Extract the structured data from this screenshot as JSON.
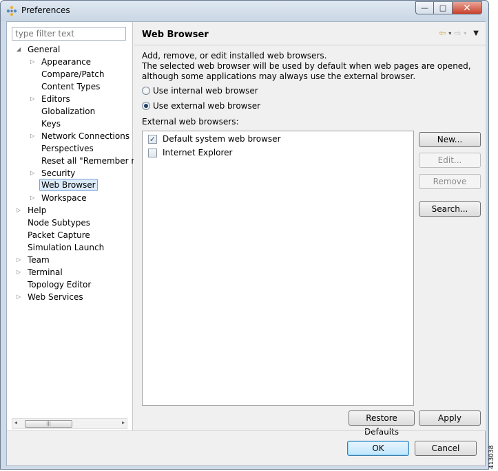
{
  "window": {
    "title": "Preferences",
    "minimize": "—",
    "maximize": "□",
    "close": "✕"
  },
  "filter": {
    "placeholder": "type filter text"
  },
  "tree": {
    "items": [
      {
        "label": "General",
        "arrow": "◢"
      },
      {
        "label": "Appearance",
        "arrow": "▷"
      },
      {
        "label": "Compare/Patch"
      },
      {
        "label": "Content Types"
      },
      {
        "label": "Editors",
        "arrow": "▷"
      },
      {
        "label": "Globalization"
      },
      {
        "label": "Keys"
      },
      {
        "label": "Network Connections",
        "arrow": "▷"
      },
      {
        "label": "Perspectives"
      },
      {
        "label": "Reset all \"Remember m"
      },
      {
        "label": "Security",
        "arrow": "▷"
      },
      {
        "label": "Web Browser"
      },
      {
        "label": "Workspace",
        "arrow": "▷"
      },
      {
        "label": "Help",
        "arrow": "▷"
      },
      {
        "label": "Node Subtypes"
      },
      {
        "label": "Packet Capture"
      },
      {
        "label": "Simulation Launch"
      },
      {
        "label": "Team",
        "arrow": "▷"
      },
      {
        "label": "Terminal",
        "arrow": "▷"
      },
      {
        "label": "Topology Editor"
      },
      {
        "label": "Web Services",
        "arrow": "▷"
      }
    ],
    "scroll": {
      "left": "◂",
      "right": "▸",
      "grip": "|||"
    }
  },
  "page": {
    "title": "Web Browser",
    "nav": {
      "back": "⇦",
      "dropdown": "▾",
      "forward": "⇨",
      "menu": "▼"
    },
    "desc_line1": "Add, remove, or edit installed web browsers.",
    "desc_line2": "The selected web browser will be used by default when web pages are opened, although some applications may always use the external browser.",
    "radio_internal": "Use internal web browser",
    "radio_external": "Use external web browser",
    "selected_radio": "external",
    "list_label": "External web browsers:",
    "browsers": [
      {
        "name": "Default system web browser",
        "checked": true,
        "mark": "✓"
      },
      {
        "name": "Internet Explorer",
        "checked": false,
        "mark": ""
      }
    ],
    "buttons": {
      "new": "New...",
      "edit": "Edit...",
      "remove": "Remove",
      "search": "Search...",
      "restore": "Restore Defaults",
      "apply": "Apply"
    }
  },
  "footer": {
    "ok": "OK",
    "cancel": "Cancel"
  },
  "figure_code": "413038"
}
